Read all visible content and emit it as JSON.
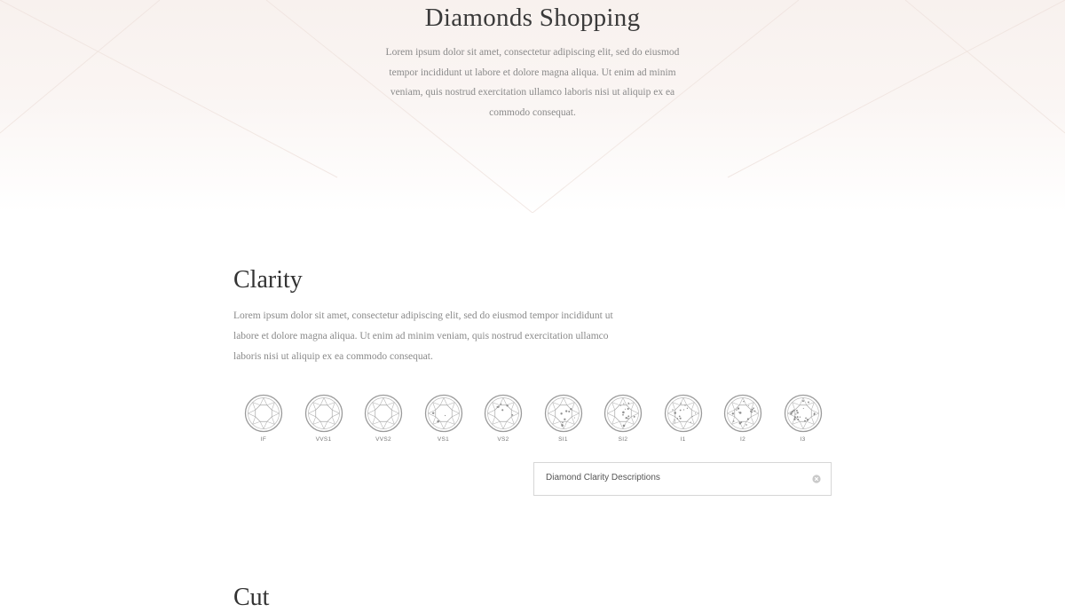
{
  "hero": {
    "title": "Diamonds Shopping",
    "text": "Lorem ipsum dolor sit amet, consectetur adipiscing elit, sed do eiusmod tempor incididunt ut labore et dolore magna aliqua. Ut enim ad minim veniam, quis nostrud exercitation ullamco laboris nisi ut aliquip ex ea commodo consequat."
  },
  "clarity": {
    "title": "Clarity",
    "text": "Lorem ipsum dolor sit amet, consectetur adipiscing elit, sed do eiusmod tempor incididunt ut labore et dolore magna aliqua. Ut enim ad minim veniam, quis nostrud exercitation ullamco laboris nisi ut aliquip ex ea commodo consequat.",
    "grades": [
      {
        "label": "IF",
        "icon": "diamond-clarity-icon"
      },
      {
        "label": "VVS1",
        "icon": "diamond-clarity-icon"
      },
      {
        "label": "VVS2",
        "icon": "diamond-clarity-icon"
      },
      {
        "label": "VS1",
        "icon": "diamond-clarity-icon"
      },
      {
        "label": "VS2",
        "icon": "diamond-clarity-icon"
      },
      {
        "label": "SI1",
        "icon": "diamond-clarity-icon"
      },
      {
        "label": "SI2",
        "icon": "diamond-clarity-icon"
      },
      {
        "label": "I1",
        "icon": "diamond-clarity-icon"
      },
      {
        "label": "I2",
        "icon": "diamond-clarity-icon"
      },
      {
        "label": "I3",
        "icon": "diamond-clarity-icon"
      }
    ],
    "accordion": {
      "title": "Diamond Clarity Descriptions",
      "icon": "close-circle-icon"
    }
  },
  "next_section": {
    "title": "Cut"
  },
  "colors": {
    "hero_tint": "#f8f1ee",
    "heading": "#333333",
    "body_text": "#8a8a8a",
    "border": "#d6d6d6"
  }
}
